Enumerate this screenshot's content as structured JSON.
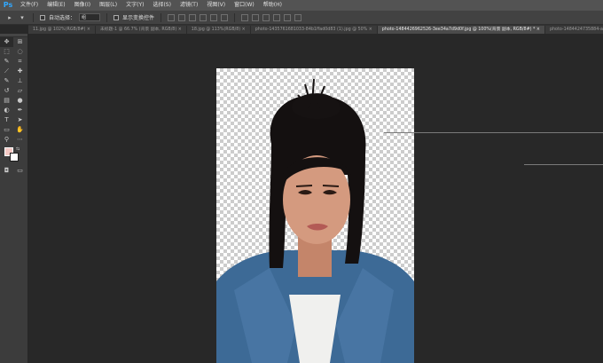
{
  "menubar": {
    "logo": "Ps",
    "items": [
      "文件(F)",
      "编辑(E)",
      "图像(I)",
      "图层(L)",
      "文字(Y)",
      "选择(S)",
      "滤镜(T)",
      "视图(V)",
      "窗口(W)",
      "帮助(H)"
    ]
  },
  "options": {
    "auto_select_label": "自动选择：",
    "auto_select_value": "组",
    "show_transform_label": "显示变换控件"
  },
  "tabs": [
    "11.jpg @ 102%(RGB/8#) ×",
    "未标题-1 @ 66.7% (背景 副本, RGB/8) ×",
    "18.jpg @ 113%(RGB/8) ×",
    "photo-1435761681033-84b1ffad0d83 (1).jpg @ 50% ×",
    "photo-1484426962526-3ee34a7d9d0f.jpg @ 100%(背景 副本, RGB/8#) * ×",
    "photo-1484424735884-a5d8..."
  ],
  "active_tab_index": 4,
  "tools": [
    [
      "move-icon",
      "artboard-icon"
    ],
    [
      "marquee-icon",
      "lasso-icon"
    ],
    [
      "quick-select-icon",
      "crop-icon"
    ],
    [
      "eyedropper-icon",
      "healing-brush-icon"
    ],
    [
      "brush-icon",
      "clone-stamp-icon"
    ],
    [
      "history-brush-icon",
      "eraser-icon"
    ],
    [
      "gradient-icon",
      "blur-icon"
    ],
    [
      "dodge-icon",
      "pen-icon"
    ],
    [
      "type-icon",
      "path-select-icon"
    ],
    [
      "rectangle-icon",
      "hand-icon"
    ],
    [
      "zoom-icon",
      "more-icon"
    ]
  ],
  "colors": {
    "foreground": "#f4c8c4",
    "background": "#ffffff",
    "accent": "#31a8ff"
  },
  "document": {
    "content": "woman in denim jacket on transparent background"
  }
}
